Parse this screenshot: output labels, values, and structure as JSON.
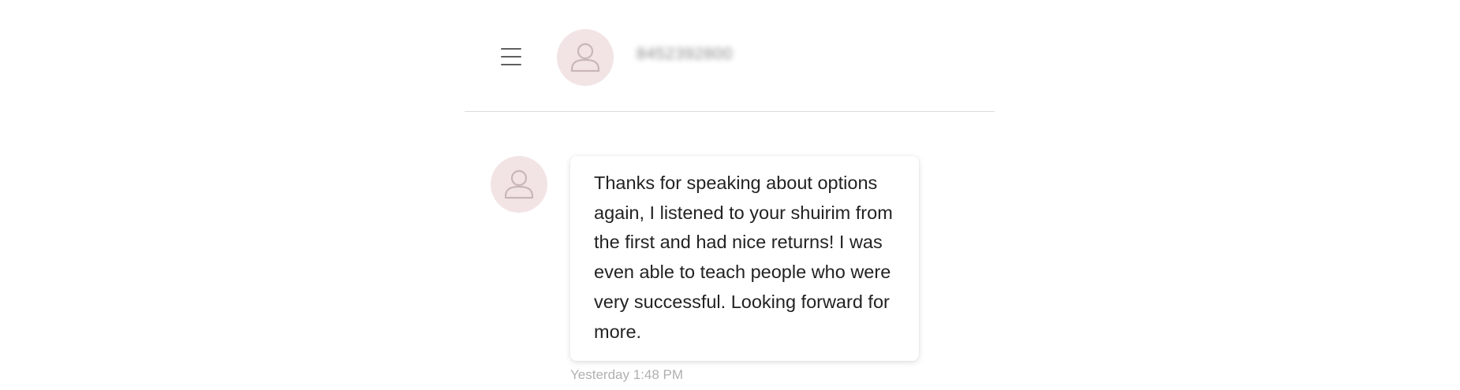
{
  "header": {
    "menu_icon": "hamburger-menu-icon",
    "avatar_icon": "user-icon",
    "contact_name": "8452392800"
  },
  "message": {
    "avatar_icon": "user-icon",
    "text": "Thanks for speaking about options again, I listened to your shuirim from the first and had nice returns! I was even able to teach people who were very successful. Looking forward for more.",
    "timestamp": "Yesterday 1:48 PM"
  },
  "colors": {
    "avatar_bg": "#f2e4e5",
    "avatar_stroke": "#c9b7b8",
    "divider": "#dcdcdc",
    "text": "#222222",
    "timestamp": "#b0b0b0"
  }
}
